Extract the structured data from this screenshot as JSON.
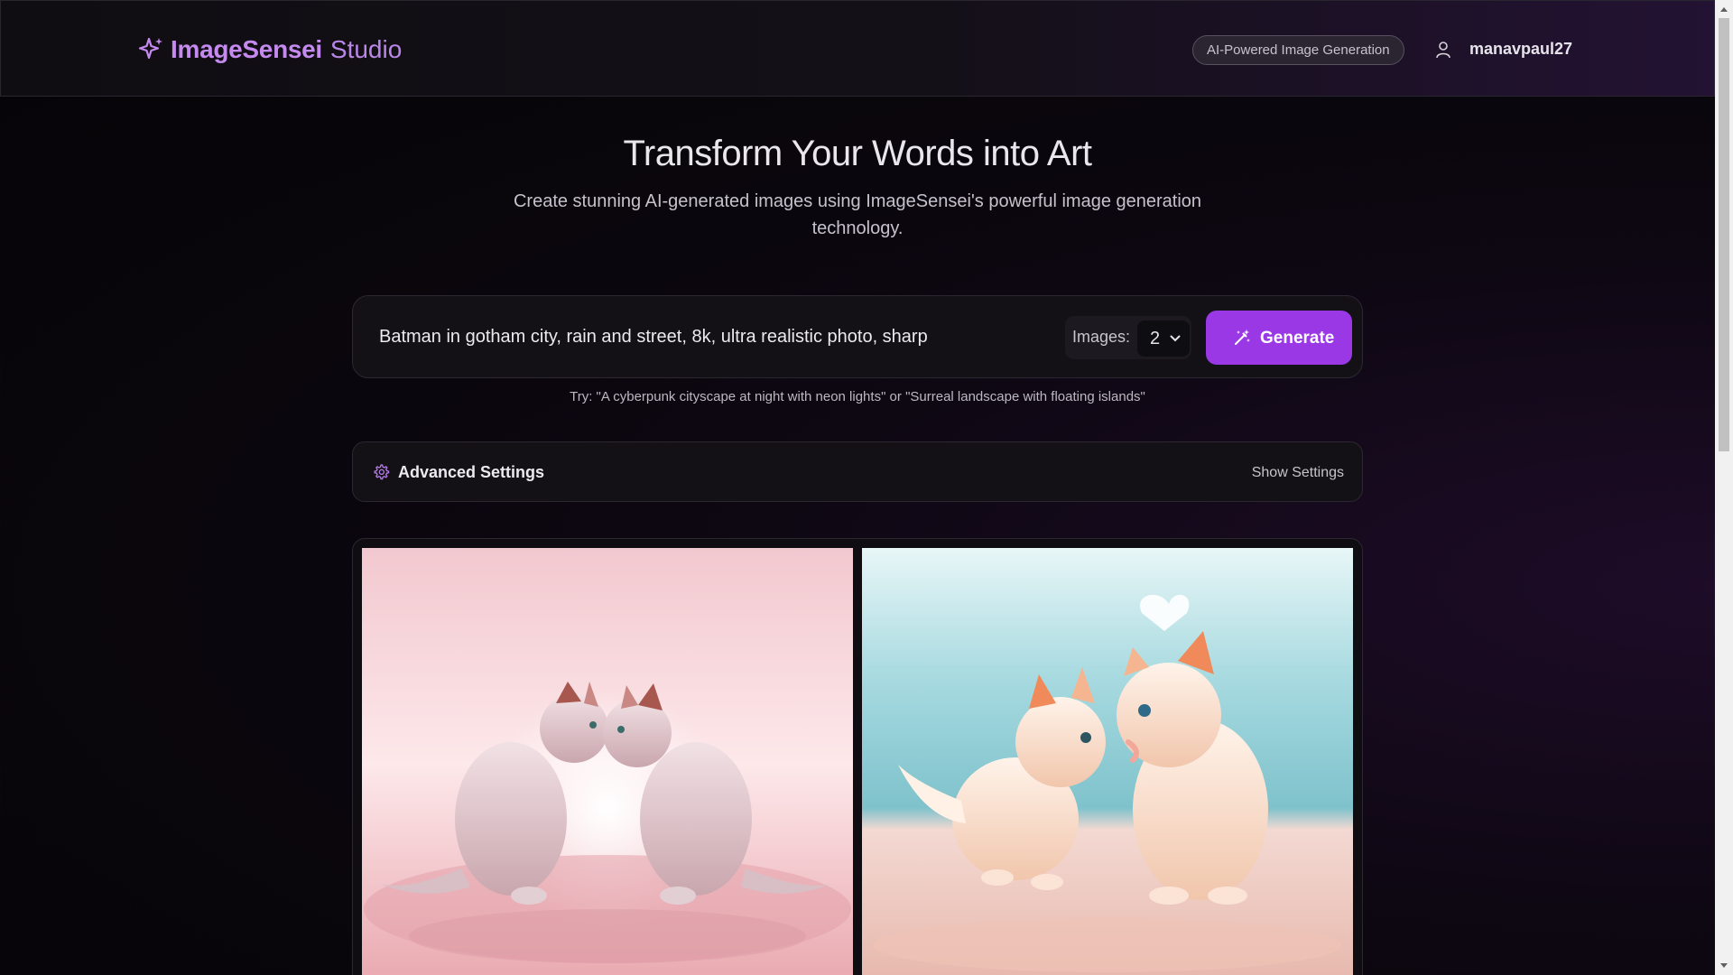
{
  "header": {
    "brand": "ImageSensei",
    "brand_suffix": "Studio",
    "badge": "AI-Powered Image Generation",
    "username": "manavpaul27"
  },
  "hero": {
    "title": "Transform Your Words into Art",
    "subtitle": "Create stunning AI-generated images using ImageSensei's powerful image generation technology."
  },
  "prompt": {
    "value": "Batman in gotham city, rain and street, 8k, ultra realistic photo, sharp",
    "images_label": "Images:",
    "images_count": "2",
    "generate_label": "Generate",
    "hint": "Try: \"A cyberpunk cityscape at night with neon lights\" or \"Surreal landscape with floating islands\""
  },
  "settings": {
    "title": "Advanced Settings",
    "toggle_label": "Show Settings"
  },
  "gallery": {
    "images": [
      {
        "icon": "generated-image-kittens-pink"
      },
      {
        "icon": "generated-image-kittens-blue"
      }
    ]
  },
  "colors": {
    "accent": "#9a38e6",
    "brand": "#c58af0",
    "background": "#050406"
  }
}
